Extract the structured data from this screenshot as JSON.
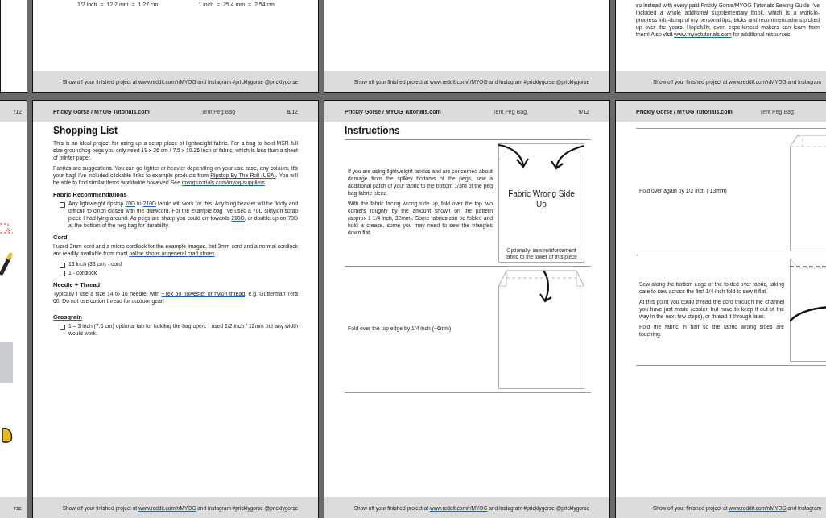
{
  "top_row": [
    {
      "blocks": [
        {
          "kind": "conversions",
          "items": [
            "1/2 inch  =  12.7 mm  =  1.27 cm",
            "1 inch  =  25.4 mm  =  2.54 cm"
          ]
        }
      ],
      "footer": [
        {
          "text": "Show off your finished project at "
        },
        {
          "text": "www.reddit.com/r/MYOG",
          "link": true
        },
        {
          "text": " and Instagram #pricklygorse @pricklygorse"
        }
      ]
    },
    {
      "footer": [
        {
          "text": "Show off your finished project at "
        },
        {
          "text": "www.reddit.com/r/MYOG",
          "link": true
        },
        {
          "text": " and Instagram #pricklygorse @pricklygorse"
        }
      ]
    },
    {
      "blocks": [
        {
          "kind": "paragraph",
          "segments": [
            {
              "text": "so instead with every paid Prickly Gorse/MYOG Tutorials Sewing Guide I've included a whole additional supplementary book, which is a work-in-progress info-dump of my personal tips, tricks and recommendations picked up over the years. Hopefully, even experienced makers can learn from them! Also visit "
            },
            {
              "text": "www.myogtutorials.com",
              "link": true
            },
            {
              "text": " for additional resources!"
            }
          ]
        }
      ],
      "footer": [
        {
          "text": "Show off your finished project at "
        },
        {
          "text": "www.reddit.com/r/MYOG",
          "link": true
        },
        {
          "text": " and Instagram"
        }
      ]
    }
  ],
  "bottom_row": [
    {
      "header": {
        "page": "/12"
      },
      "footer": [
        {
          "text": "rse"
        }
      ]
    },
    {
      "header": {
        "site": "Prickly Gorse / MYOG Tutorials.com",
        "title": "Tent Peg Bag",
        "page": "8/12"
      },
      "blocks": [
        {
          "kind": "title",
          "text": "Shopping List"
        },
        {
          "kind": "paragraph",
          "segments": [
            {
              "text": "This is an ideal project for using up a scrap piece of lightweight fabric. For a bag to hold MSR full size groundhog pegs you only need 19 x 26 cm / 7.5 x 10.25 inch of fabric, which is less than a sheet of printer paper."
            }
          ]
        },
        {
          "kind": "paragraph",
          "segments": [
            {
              "text": "Fabrics are suggestions. You can go lighter or heavier depending on your use case, any colours, it's your bag! I've included clickable links to example products from "
            },
            {
              "text": "Ripstop By The Roll (USA)",
              "link": true
            },
            {
              "text": ". You will be able to find similar items worldwide however! See "
            },
            {
              "text": "myogtutorials.com/myog-suppliers",
              "link": true
            }
          ]
        },
        {
          "kind": "subheading",
          "text": "Fabric Recommendations"
        },
        {
          "kind": "checklist",
          "items": [
            {
              "checked": false,
              "segments": [
                {
                  "text": "Any lightweight ripstop "
                },
                {
                  "text": "70D",
                  "link": true
                },
                {
                  "text": " to "
                },
                {
                  "text": "210D",
                  "link": true
                },
                {
                  "text": " fabric will work for this. Anything heavier will be fiddly and difficult to cinch closed with the drawcord. For the example bag I've used a 70D silnylon scrap piece I had lying around. As pegs are sharp you could err towards "
                },
                {
                  "text": "210D",
                  "link": true
                },
                {
                  "text": ", or double up on 70D at the bottom of the peg bag for durability."
                }
              ]
            }
          ]
        },
        {
          "kind": "subheading",
          "text": "Cord"
        },
        {
          "kind": "paragraph",
          "segments": [
            {
              "text": "I used 2mm cord and a micro cordlock for the example images, but 3mm cord and a normal cordlock are readily available from most "
            },
            {
              "text": "online shops or general craft stores",
              "link": true
            },
            {
              "text": "."
            }
          ]
        },
        {
          "kind": "checklist",
          "items": [
            {
              "checked": false,
              "segments": [
                {
                  "text": "13 inch (33 cm) - cord"
                }
              ]
            },
            {
              "checked": false,
              "segments": [
                {
                  "text": "1 - cordlock"
                }
              ]
            }
          ]
        },
        {
          "kind": "subheading",
          "text": "Needle + Thread"
        },
        {
          "kind": "paragraph",
          "segments": [
            {
              "text": "Typically I use a size 14 to 16 needle, with "
            },
            {
              "text": "~Tex 50 polyester or nylon thread",
              "link": true
            },
            {
              "text": ", e.g. Gutterman Tera 60. Do not use cotton thread for outdoor gear!"
            }
          ]
        },
        {
          "kind": "subheading",
          "text": "Grosgrain",
          "link": true
        },
        {
          "kind": "checklist",
          "items": [
            {
              "checked": false,
              "segments": [
                {
                  "text": "1 – 3 inch (7.6 cm) optional tab for holding the bag open. I used 1/2 inch / 12mm but any width would work."
                }
              ]
            }
          ]
        }
      ],
      "footer": [
        {
          "text": "Show off your finished project at "
        },
        {
          "text": "www.reddit.com/r/MYOG",
          "link": true
        },
        {
          "text": " and Instagram #pricklygorse @pricklygorse"
        }
      ]
    },
    {
      "header": {
        "site": "Prickly Gorse / MYOG Tutorials.com",
        "title": "Tent Peg Bag",
        "page": "9/12"
      },
      "blocks": [
        {
          "kind": "title",
          "text": "Instructions"
        },
        {
          "kind": "step",
          "paragraphs": [
            "If you are using lightweight fabrics and are concerned about damage from the spikey bottoms of the pegs, sew a additional patch of your fabric to the bottom 1/3rd of the peg bag fabric piece.",
            "With the fabric facing wrong side up, fold over the top two corners roughly by the amount shown on the pattern (approx 1 1/4 inch, 32mm). Some fabrics can be folded and hold a crease, some you may need to sew the triangles down flat."
          ],
          "diagram": {
            "kind": "corners",
            "label": "Fabric Wrong Side Up",
            "note": "Optionally, sew reinforcement fabric to the lower of this piece"
          }
        },
        {
          "kind": "step",
          "paragraphs": [
            "Fold over the top edge by 1/4 inch (~6mm)"
          ],
          "diagram": {
            "kind": "fold-top"
          }
        }
      ],
      "footer": [
        {
          "text": "Show off your finished project at "
        },
        {
          "text": "www.reddit.com/r/MYOG",
          "link": true
        },
        {
          "text": " and Instagram #pricklygorse @pricklygorse"
        }
      ]
    },
    {
      "header": {
        "site": "Prickly Gorse / MYOG Tutorials.com",
        "title": "Tent Peg Bag"
      },
      "blocks": [
        {
          "kind": "step",
          "paragraphs": [
            "Fold over again by 1/2 inch ( 13mm)"
          ],
          "diagram": {
            "kind": "fold-again"
          }
        },
        {
          "kind": "step",
          "paragraphs": [
            "Sew along the bottom edge of the folded over fabric, taking care to sew across the first 1/4 inch fold to sew it flat.",
            "At this point you could thread the cord through the channel you have just made (easier, but have to keep it out of the way in the next few steps), or thread it through later.",
            "Fold the fabric in half so the fabric wrong sides are touching."
          ],
          "diagram": {
            "kind": "stitch"
          }
        }
      ],
      "footer": [
        {
          "text": "Show off your finished project at "
        },
        {
          "text": "www.reddit.com/r/MYOG",
          "link": true
        },
        {
          "text": " and Instagram"
        }
      ]
    }
  ]
}
